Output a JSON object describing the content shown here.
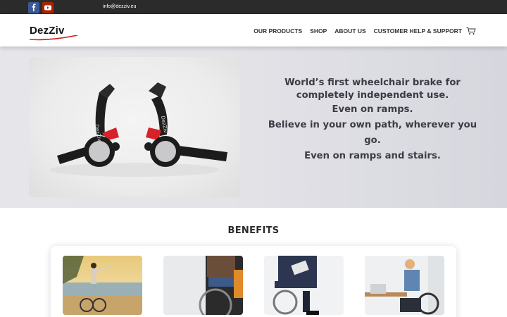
{
  "topbar": {
    "email": "info@dezziv.eu",
    "social": [
      {
        "icon": "facebook-icon",
        "color": "#3b5998"
      },
      {
        "icon": "youtube-icon",
        "color": "#a82400"
      }
    ]
  },
  "header": {
    "logo": "DezZiv",
    "nav": [
      {
        "label": "OUR PRODUCTS"
      },
      {
        "label": "SHOP"
      },
      {
        "label": "ABOUT US"
      },
      {
        "label": "CUSTOMER HELP & SUPPORT"
      }
    ],
    "cart_icon": "cart-icon"
  },
  "hero": {
    "lines": [
      "World’s first wheelchair brake for completely independent use.",
      "Even on ramps.",
      "Believe in your own path, wherever you go.",
      "Even on ramps and stairs."
    ],
    "product_label": "DezZiv"
  },
  "benefits": {
    "title": "BENEFITS"
  },
  "colors": {
    "topbar": "#2b2b2b",
    "logo_accent": "#d11f1f",
    "hero_text": "#3c3c46",
    "brake_red": "#d8222a"
  }
}
